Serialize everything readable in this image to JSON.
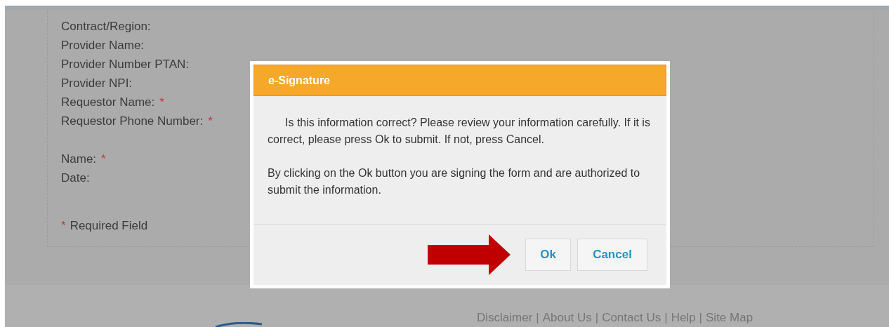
{
  "form": {
    "field_groups": [
      [
        {
          "label": "Contract/Region:"
        },
        {
          "label": "Provider Name:"
        },
        {
          "label": "Provider Number PTAN:"
        },
        {
          "label": "Provider NPI:"
        },
        {
          "label": "Requestor Name:",
          "required_mark": "*"
        },
        {
          "label": "Requestor Phone Number:",
          "required_mark": "*"
        }
      ],
      [
        {
          "label": "Name:",
          "required_mark": "*"
        },
        {
          "label": "Date:"
        }
      ]
    ],
    "required_note": {
      "mark": "*",
      "text": "Required Field"
    }
  },
  "dialog": {
    "title": "e-Signature",
    "paragraphs": [
      "Is this information correct? Please review your information carefully. If it is correct, please press Ok to submit. If not, press Cancel.",
      "By clicking on the Ok button you are signing the form and are authorized to submit the information."
    ],
    "buttons": [
      "Ok",
      "Cancel"
    ]
  },
  "footer": {
    "links": [
      "Disclaimer",
      "About Us",
      "Contact Us",
      "Help",
      "Site Map"
    ],
    "separator": "|"
  }
}
